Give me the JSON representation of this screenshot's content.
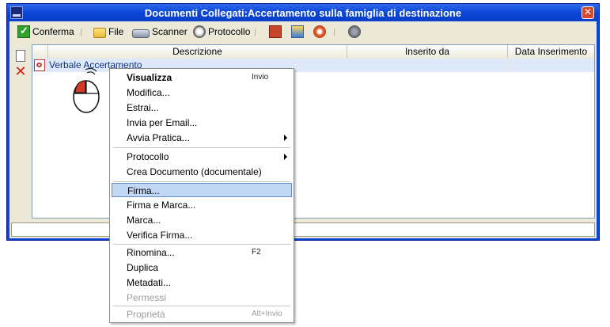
{
  "window": {
    "title": "Documenti Collegati:Accertamento sulla famiglia di destinazione",
    "close_glyph": "✕"
  },
  "toolbar": {
    "conferma": "Conferma",
    "file": "File",
    "scanner": "Scanner",
    "protocollo": "Protocollo",
    "icons": [
      "check-icon",
      "folder-icon",
      "scanner-icon",
      "protocol-icon",
      "document-tool-icon",
      "edit-tool-icon",
      "stamp-icon",
      "disk-icon"
    ]
  },
  "sidebar": {
    "icons": [
      "new-document-icon",
      "delete-icon"
    ],
    "delete_glyph": "✕"
  },
  "grid": {
    "columns": [
      "Descrizione",
      "Inserito da",
      "Data Inserimento"
    ],
    "rows": [
      {
        "descrizione": "Verbale Accertamento",
        "inserito_da": "",
        "data_inserimento": ""
      }
    ]
  },
  "status_bar": {
    "text": ""
  },
  "context_menu": {
    "items": [
      {
        "label": "Visualizza",
        "shortcut": "Invio",
        "bold": true
      },
      {
        "label": "Modifica..."
      },
      {
        "label": "Estrai..."
      },
      {
        "label": "Invia per Email..."
      },
      {
        "label": "Avvia Pratica...",
        "submenu": true
      },
      {
        "label": "Protocollo",
        "submenu": true
      },
      {
        "label": "Crea Documento (documentale)"
      },
      {
        "label": "Firma...",
        "highlighted": true
      },
      {
        "label": "Firma e Marca..."
      },
      {
        "label": "Marca..."
      },
      {
        "label": "Verifica Firma..."
      },
      {
        "label": "Rinomina...",
        "shortcut": "F2"
      },
      {
        "label": "Duplica"
      },
      {
        "label": "Metadati..."
      },
      {
        "label": "Permessi",
        "disabled": true
      },
      {
        "label": "Proprietà",
        "shortcut": "Alt+Invio",
        "disabled": true
      }
    ]
  },
  "colors": {
    "title_bar": "#0b46d6",
    "highlight": "#c1d7f4",
    "row_selected": "#dde9f9"
  }
}
